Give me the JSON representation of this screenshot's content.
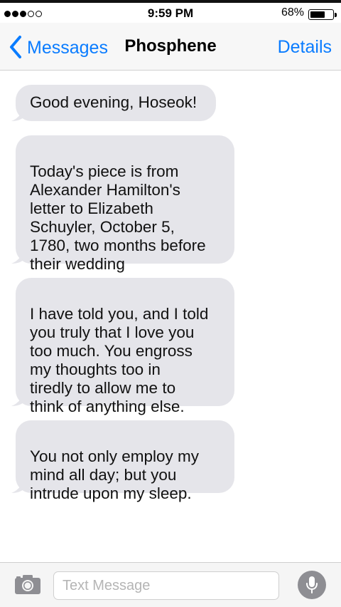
{
  "status_bar": {
    "signal_dots": [
      true,
      true,
      true,
      false,
      false
    ],
    "time": "9:59 PM",
    "battery_percent": "68%",
    "battery_level": 0.68
  },
  "nav": {
    "back_label": "Messages",
    "title": "Phosphene",
    "details_label": "Details",
    "accent_color": "#0a7cff"
  },
  "messages": [
    {
      "text": "Good evening, Hoseok!"
    },
    {
      "text": "Today's piece is from\nAlexander Hamilton's\nletter to Elizabeth\nSchuyler, October 5,\n1780, two months before\ntheir wedding"
    },
    {
      "text": "I have told you, and I told\nyou truly that I love you\ntoo much. You engross\nmy thoughts too in\ntiredly to allow me to\nthink of anything else."
    },
    {
      "text": "You not only employ my\nmind all day; but you\nintrude upon my sleep."
    }
  ],
  "compose": {
    "placeholder": "Text Message",
    "camera_icon": "camera-icon",
    "mic_icon": "microphone-icon"
  }
}
